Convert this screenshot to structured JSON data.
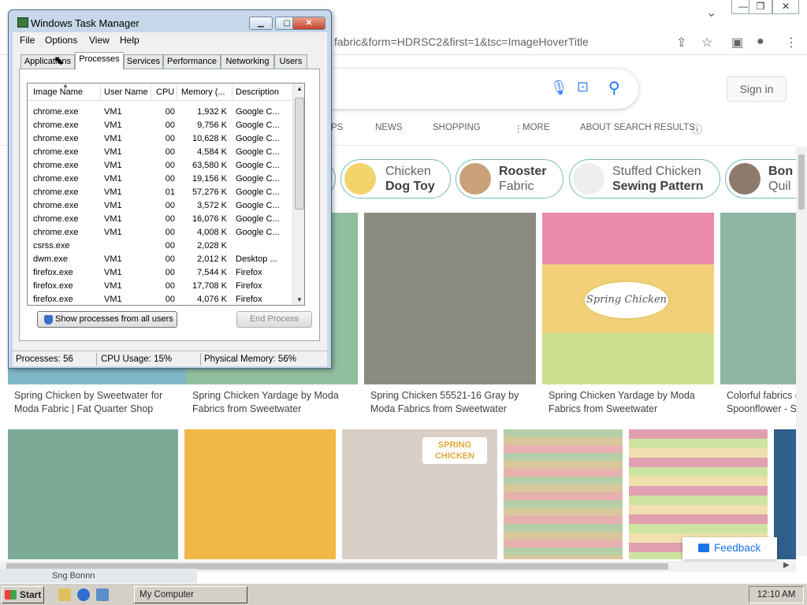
{
  "browser": {
    "address_bar": {
      "url_fragment": "fabric&form=HDRSC2&first=1&tsc=ImageHoverTitle"
    },
    "signin_label": "Sign in",
    "nav_tabs": [
      "PS",
      "NEWS",
      "SHOPPING",
      "MORE",
      "ABOUT SEARCH RESULTS"
    ],
    "chips": [
      {
        "line1": "Chicken",
        "line2": "Dog Toy",
        "bold_line": 2
      },
      {
        "line1": "Rooster",
        "line2": "Fabric",
        "bold_line": 1
      },
      {
        "line1": "Stuffed Chicken",
        "line2": "Sewing Pattern",
        "bold_line": 2
      },
      {
        "line1": "Bon",
        "line2": "Quil",
        "bold_line": 1
      }
    ],
    "results_row1": [
      {
        "caption": "Spring Chicken by Sweetwater for Moda Fabric | Fat Quarter Shop",
        "color": "#7fb8c9"
      },
      {
        "caption": "Spring Chicken Yardage by Moda Fabrics from Sweetwater",
        "color": "#8fbf9e"
      },
      {
        "caption": "Spring Chicken 55521-16 Gray by Moda Fabrics from Sweetwater",
        "color": "#8c8b82"
      },
      {
        "caption": "Spring Chicken Yardage by Moda Fabrics from Sweetwater",
        "color": "#e8c9a6",
        "overlay": "Spring Chicken"
      },
      {
        "caption": "Colorful fabrics c Spoonflower - S",
        "color": "#8fb5a3"
      }
    ],
    "results_row2": [
      {
        "color": "#7bab97"
      },
      {
        "color": "#f2b847"
      },
      {
        "color": "#d9cfc6",
        "overlay": "SPRING CHICKEN"
      },
      {
        "color": "#9ab79a"
      },
      {
        "color": "#d9a4a4"
      },
      {
        "color": "#2f5e8a"
      }
    ],
    "feedback_label": "Feedback"
  },
  "taskmanager": {
    "title": "Windows Task Manager",
    "menu": [
      "File",
      "Options",
      "View",
      "Help"
    ],
    "tabs": [
      "Applications",
      "Processes",
      "Services",
      "Performance",
      "Networking",
      "Users"
    ],
    "selected_tab": "Processes",
    "columns": [
      "Image Name",
      "User Name",
      "CPU",
      "Memory (...",
      "Description"
    ],
    "processes": [
      {
        "image": "chrome.exe",
        "user": "VM1",
        "cpu": "00",
        "mem": "1,932 K",
        "desc": "Google C..."
      },
      {
        "image": "chrome.exe",
        "user": "VM1",
        "cpu": "00",
        "mem": "9,756 K",
        "desc": "Google C..."
      },
      {
        "image": "chrome.exe",
        "user": "VM1",
        "cpu": "00",
        "mem": "10,628 K",
        "desc": "Google C..."
      },
      {
        "image": "chrome.exe",
        "user": "VM1",
        "cpu": "00",
        "mem": "4,584 K",
        "desc": "Google C..."
      },
      {
        "image": "chrome.exe",
        "user": "VM1",
        "cpu": "00",
        "mem": "63,580 K",
        "desc": "Google C..."
      },
      {
        "image": "chrome.exe",
        "user": "VM1",
        "cpu": "00",
        "mem": "19,156 K",
        "desc": "Google C..."
      },
      {
        "image": "chrome.exe",
        "user": "VM1",
        "cpu": "01",
        "mem": "57,276 K",
        "desc": "Google C..."
      },
      {
        "image": "chrome.exe",
        "user": "VM1",
        "cpu": "00",
        "mem": "3,572 K",
        "desc": "Google C..."
      },
      {
        "image": "chrome.exe",
        "user": "VM1",
        "cpu": "00",
        "mem": "16,076 K",
        "desc": "Google C..."
      },
      {
        "image": "chrome.exe",
        "user": "VM1",
        "cpu": "00",
        "mem": "4,008 K",
        "desc": "Google C..."
      },
      {
        "image": "csrss.exe",
        "user": "",
        "cpu": "00",
        "mem": "2,028 K",
        "desc": ""
      },
      {
        "image": "dwm.exe",
        "user": "VM1",
        "cpu": "00",
        "mem": "2,012 K",
        "desc": "Desktop ..."
      },
      {
        "image": "firefox.exe",
        "user": "VM1",
        "cpu": "00",
        "mem": "7,544 K",
        "desc": "Firefox"
      },
      {
        "image": "firefox.exe",
        "user": "VM1",
        "cpu": "00",
        "mem": "17,708 K",
        "desc": "Firefox"
      },
      {
        "image": "firefox.exe",
        "user": "VM1",
        "cpu": "00",
        "mem": "4,076 K",
        "desc": "Firefox"
      }
    ],
    "show_all_label": "Show processes from all users",
    "end_process_label": "End Process",
    "status": {
      "processes": "Processes: 56",
      "cpu": "CPU Usage: 15%",
      "memory": "Physical Memory: 56%"
    }
  },
  "taskbar": {
    "start_label": "Start",
    "task_item": "My Computer",
    "clock": "12:10 AM",
    "under_window_text": "Sng Bonnn"
  }
}
